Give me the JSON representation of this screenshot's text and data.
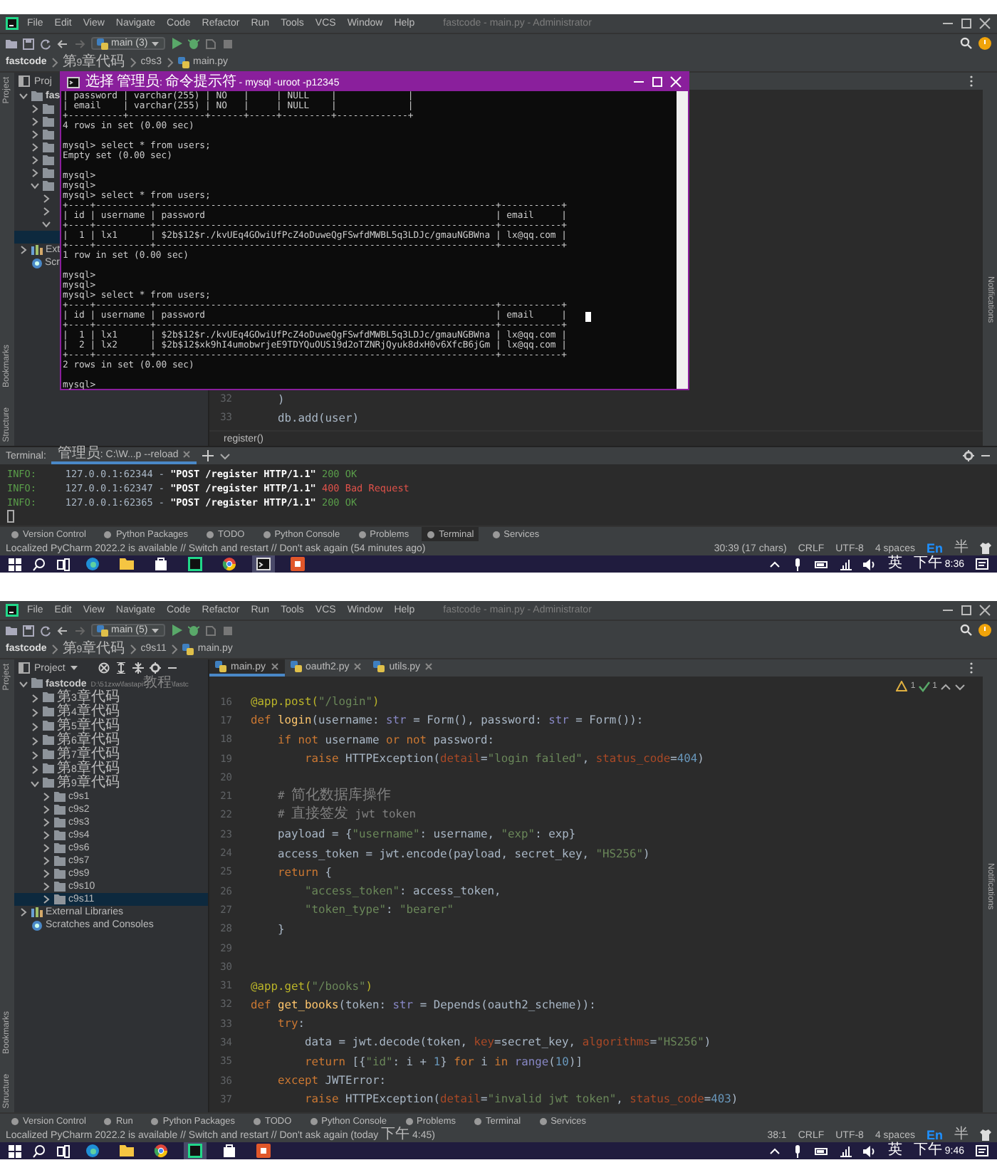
{
  "screens": [
    {
      "title": "fastcode - main.py - Administrator",
      "menu": [
        "File",
        "Edit",
        "View",
        "Navigate",
        "Code",
        "Refactor",
        "Run",
        "Tools",
        "VCS",
        "Window",
        "Help"
      ],
      "branch": "main (3)",
      "breadcrumb": [
        "fastcode",
        "第9章代码",
        "c9s3",
        "main.py"
      ],
      "side_strip": {
        "top": "Project",
        "bottom": [
          "Bookmarks",
          "Structure"
        ]
      },
      "project_panel": {
        "header": "Proj",
        "tree": [
          {
            "kind": "root",
            "label": "fas",
            "expanded": true,
            "selected": false,
            "children": [
              {
                "kind": "folder",
                "expanded": false,
                "selected": false
              },
              {
                "kind": "folder",
                "expanded": false,
                "selected": false
              },
              {
                "kind": "folder",
                "expanded": false,
                "selected": false
              },
              {
                "kind": "folder",
                "expanded": false,
                "selected": false
              },
              {
                "kind": "folder",
                "expanded": false,
                "selected": false
              },
              {
                "kind": "folder",
                "expanded": false,
                "selected": false
              },
              {
                "kind": "folder",
                "expanded": true,
                "selected": false,
                "children": [
                  {
                    "kind": "folder",
                    "expanded": false,
                    "selected": false
                  },
                  {
                    "kind": "folder",
                    "expanded": false,
                    "selected": false
                  },
                  {
                    "kind": "folder",
                    "expanded": true,
                    "selected": false,
                    "children": [
                      {
                        "selected": true
                      }
                    ]
                  }
                ]
              }
            ]
          },
          {
            "kind": "library",
            "label": "Ext",
            "expanded": false,
            "selected": false
          },
          {
            "kind": "scratches",
            "label": "Scr",
            "selected": false
          }
        ]
      },
      "editor": {
        "lines": [
          {
            "number": "32",
            "tokens": [
              {
                "kind": "plain",
                "text": "    )"
              }
            ]
          },
          {
            "number": "33",
            "tokens": [
              {
                "kind": "plain",
                "text": "    db.add(user)"
              }
            ]
          }
        ],
        "breadcrumb": "register()"
      },
      "terminal": {
        "label": "Terminal:",
        "tabs": [
          {
            "label": "管理员: C:\\W...p --reload",
            "selected": true
          }
        ],
        "lines": [
          {
            "tokens": [
              {
                "kind": "info",
                "text": "INFO:"
              },
              {
                "kind": "plain",
                "text": "     127.0.0.1:62344 - "
              },
              {
                "kind": "bold",
                "text": "\"POST /register HTTP/1.1\""
              },
              {
                "kind": "ok",
                "text": " 200 OK"
              }
            ]
          },
          {
            "tokens": [
              {
                "kind": "info",
                "text": "INFO:"
              },
              {
                "kind": "plain",
                "text": "     127.0.0.1:62347 - "
              },
              {
                "kind": "bold",
                "text": "\"POST /register HTTP/1.1\""
              },
              {
                "kind": "err",
                "text": " 400 Bad Request"
              }
            ]
          },
          {
            "tokens": [
              {
                "kind": "info",
                "text": "INFO:"
              },
              {
                "kind": "plain",
                "text": "     127.0.0.1:62365 - "
              },
              {
                "kind": "bold",
                "text": "\"POST /register HTTP/1.1\""
              },
              {
                "kind": "ok",
                "text": " 200 OK"
              }
            ]
          }
        ]
      },
      "console_window": {
        "title": "选择 管理员: 命令提示符 - mysql -uroot -p12345",
        "lines": [
          {
            "text": "| password | varchar(255) | NO   |     | NULL    |             |"
          },
          {
            "text": "| email    | varchar(255) | NO   |     | NULL    |             |"
          },
          {
            "text": "+----------+--------------+------+-----+---------+-------------+"
          },
          {
            "text": "4 rows in set (0.00 sec)"
          },
          {
            "text": "mysql> select * from users;",
            "gap_before": true
          },
          {
            "text": "Empty set (0.00 sec)"
          },
          {
            "text": "mysql>",
            "gap_before": true
          },
          {
            "text": "mysql>"
          },
          {
            "text": "mysql> select * from users;"
          },
          {
            "text": "+----+----------+--------------------------------------------------------------+-----------+"
          },
          {
            "text": "| id | username | password                                                     | email     |"
          },
          {
            "text": "+----+----------+--------------------------------------------------------------+-----------+"
          },
          {
            "text": "|  1 | lx1      | $2b$12$r./kvUEq4GOwiUfPcZ4oDuweQgFSwfdMWBL5q3LDJc/gmauNGBWna | lx@qq.com |"
          },
          {
            "text": "+----+----------+--------------------------------------------------------------+-----------+"
          },
          {
            "text": "1 row in set (0.00 sec)"
          },
          {
            "text": "mysql>",
            "gap_before": true
          },
          {
            "text": "mysql>"
          },
          {
            "text": "mysql> select * from users;"
          },
          {
            "text": "+----+----------+--------------------------------------------------------------+-----------+"
          },
          {
            "text": "| id | username | password                                                     | email     |"
          },
          {
            "text": "+----+----------+--------------------------------------------------------------+-----------+"
          },
          {
            "text": "|  1 | lx1      | $2b$12$r./kvUEq4GOwiUfPcZ4oDuweQgFSwfdMWBL5q3LDJc/gmauNGBWna | lx@qq.com |"
          },
          {
            "text": "|  2 | lx2      | $2b$12$xk9hI4umobwrjeE9TDYQuOUS19d2oTZNRjQyuk8dxH0v6XfcB6jGm | lx@qq.com |"
          },
          {
            "text": "+----+----------+--------------------------------------------------------------+-----------+"
          },
          {
            "text": "2 rows in set (0.00 sec)"
          },
          {
            "text": "mysql>",
            "gap_before": true
          }
        ]
      },
      "tool_tabs": [
        {
          "label": "Version Control",
          "selected": false
        },
        {
          "label": "Python Packages",
          "selected": false
        },
        {
          "label": "TODO",
          "selected": false
        },
        {
          "label": "Python Console",
          "selected": false
        },
        {
          "label": "Problems",
          "selected": false
        },
        {
          "label": "Terminal",
          "selected": true
        },
        {
          "label": "Services",
          "selected": false
        }
      ],
      "notifications": "Notifications",
      "status_bar": {
        "message": "Localized PyCharm 2022.2 is available // Switch and restart // Don't ask again (54 minutes ago)",
        "items": [
          "30:39 (17 chars)",
          "CRLF",
          "UTF-8",
          "4 spaces"
        ],
        "ime": "En",
        "ime_mode": "半"
      },
      "taskbar": {
        "apps": [
          {
            "kind": "browser",
            "active": false
          },
          {
            "kind": "folder",
            "active": false
          },
          {
            "kind": "store",
            "active": false
          },
          {
            "kind": "ide",
            "active": false
          },
          {
            "kind": "chrome",
            "active": false
          },
          {
            "kind": "console",
            "active": true
          },
          {
            "kind": "office",
            "active": false
          }
        ],
        "lang": "英",
        "clock": "下午 8:36"
      }
    },
    {
      "title": "fastcode - main.py - Administrator",
      "menu": [
        "File",
        "Edit",
        "View",
        "Navigate",
        "Code",
        "Refactor",
        "Run",
        "Tools",
        "VCS",
        "Window",
        "Help"
      ],
      "branch": "main (5)",
      "breadcrumb": [
        "fastcode",
        "第9章代码",
        "c9s11",
        "main.py"
      ],
      "side_strip": {
        "top": "Project",
        "bottom": [
          "Bookmarks",
          "Structure"
        ]
      },
      "project_panel": {
        "header": "Project",
        "tree": [
          {
            "kind": "root",
            "label": "fastcode",
            "path": "D:\\51zxw\\fastapi教程\\fastc",
            "expanded": true,
            "selected": false,
            "children": [
              {
                "kind": "folder",
                "label": "第3章代码",
                "expanded": false,
                "selected": false
              },
              {
                "kind": "folder",
                "label": "第4章代码",
                "expanded": false,
                "selected": false
              },
              {
                "kind": "folder",
                "label": "第5章代码",
                "expanded": false,
                "selected": false
              },
              {
                "kind": "folder",
                "label": "第6章代码",
                "expanded": false,
                "selected": false
              },
              {
                "kind": "folder",
                "label": "第7章代码",
                "expanded": false,
                "selected": false
              },
              {
                "kind": "folder",
                "label": "第8章代码",
                "expanded": false,
                "selected": false
              },
              {
                "kind": "folder",
                "label": "第9章代码",
                "expanded": true,
                "selected": false,
                "children": [
                  {
                    "kind": "folder",
                    "label": "c9s1",
                    "expanded": false,
                    "selected": false
                  },
                  {
                    "kind": "folder",
                    "label": "c9s2",
                    "expanded": false,
                    "selected": false
                  },
                  {
                    "kind": "folder",
                    "label": "c9s3",
                    "expanded": false,
                    "selected": false
                  },
                  {
                    "kind": "folder",
                    "label": "c9s4",
                    "expanded": false,
                    "selected": false
                  },
                  {
                    "kind": "folder",
                    "label": "c9s6",
                    "expanded": false,
                    "selected": false
                  },
                  {
                    "kind": "folder",
                    "label": "c9s7",
                    "expanded": false,
                    "selected": false
                  },
                  {
                    "kind": "folder",
                    "label": "c9s9",
                    "expanded": false,
                    "selected": false
                  },
                  {
                    "kind": "folder",
                    "label": "c9s10",
                    "expanded": false,
                    "selected": false
                  },
                  {
                    "kind": "folder",
                    "label": "c9s11",
                    "expanded": false,
                    "selected": true
                  }
                ]
              }
            ]
          },
          {
            "kind": "library",
            "label": "External Libraries",
            "expanded": false,
            "selected": false
          },
          {
            "kind": "scratches",
            "label": "Scratches and Consoles",
            "selected": false
          }
        ]
      },
      "editor_tabs": [
        {
          "label": "main.py",
          "selected": true
        },
        {
          "label": "oauth2.py",
          "selected": false
        },
        {
          "label": "utils.py",
          "selected": false
        }
      ],
      "inspections": {
        "warnings": "1",
        "passed": "1"
      },
      "editor": {
        "lines": [
          {
            "number": "16",
            "tokens": [
              {
                "kind": "deco",
                "text": "@app.post("
              },
              {
                "kind": "str",
                "text": "\"/login\""
              },
              {
                "kind": "deco",
                "text": ")"
              }
            ]
          },
          {
            "number": "17",
            "tokens": [
              {
                "kind": "kw",
                "text": "def "
              },
              {
                "kind": "fn",
                "text": "login"
              },
              {
                "kind": "plain",
                "text": "(username: "
              },
              {
                "kind": "builtin",
                "text": "str"
              },
              {
                "kind": "plain",
                "text": " = Form(), password: "
              },
              {
                "kind": "builtin",
                "text": "str"
              },
              {
                "kind": "plain",
                "text": " = Form()):"
              }
            ]
          },
          {
            "number": "18",
            "tokens": [
              {
                "kind": "kw",
                "text": "    if not"
              },
              {
                "kind": "plain",
                "text": " username "
              },
              {
                "kind": "kw",
                "text": "or not"
              },
              {
                "kind": "plain",
                "text": " password:"
              }
            ]
          },
          {
            "number": "19",
            "tokens": [
              {
                "kind": "kw",
                "text": "        raise"
              },
              {
                "kind": "plain",
                "text": " HTTPException("
              },
              {
                "kind": "param",
                "text": "detail"
              },
              {
                "kind": "plain",
                "text": "="
              },
              {
                "kind": "str",
                "text": "\"login failed\""
              },
              {
                "kind": "plain",
                "text": ", "
              },
              {
                "kind": "param",
                "text": "status_code"
              },
              {
                "kind": "plain",
                "text": "="
              },
              {
                "kind": "num",
                "text": "404"
              },
              {
                "kind": "plain",
                "text": ")"
              }
            ]
          },
          {
            "number": "20"
          },
          {
            "number": "21",
            "tokens": [
              {
                "kind": "comment",
                "text": "    # 简化数据库操作"
              }
            ]
          },
          {
            "number": "22",
            "tokens": [
              {
                "kind": "comment",
                "text": "    # 直接签发 jwt token"
              }
            ]
          },
          {
            "number": "23",
            "tokens": [
              {
                "kind": "plain",
                "text": "    payload = {"
              },
              {
                "kind": "str",
                "text": "\"username\""
              },
              {
                "kind": "plain",
                "text": ": username, "
              },
              {
                "kind": "str",
                "text": "\"exp\""
              },
              {
                "kind": "plain",
                "text": ": exp}"
              }
            ]
          },
          {
            "number": "24",
            "tokens": [
              {
                "kind": "plain",
                "text": "    access_token = jwt.encode(payload, secret_key, "
              },
              {
                "kind": "str",
                "text": "\"HS256\""
              },
              {
                "kind": "plain",
                "text": ")"
              }
            ]
          },
          {
            "number": "25",
            "tokens": [
              {
                "kind": "kw",
                "text": "    return"
              },
              {
                "kind": "plain",
                "text": " {"
              }
            ]
          },
          {
            "number": "26",
            "tokens": [
              {
                "kind": "str",
                "text": "        \"access_token\""
              },
              {
                "kind": "plain",
                "text": ": access_token,"
              }
            ]
          },
          {
            "number": "27",
            "tokens": [
              {
                "kind": "str",
                "text": "        \"token_type\""
              },
              {
                "kind": "plain",
                "text": ": "
              },
              {
                "kind": "str",
                "text": "\"bearer\""
              }
            ]
          },
          {
            "number": "28",
            "tokens": [
              {
                "kind": "plain",
                "text": "    }"
              }
            ]
          },
          {
            "number": "29"
          },
          {
            "number": "30"
          },
          {
            "number": "31",
            "tokens": [
              {
                "kind": "deco",
                "text": "@app.get("
              },
              {
                "kind": "str",
                "text": "\"/books\""
              },
              {
                "kind": "deco",
                "text": ")"
              }
            ]
          },
          {
            "number": "32",
            "tokens": [
              {
                "kind": "kw",
                "text": "def "
              },
              {
                "kind": "fn",
                "text": "get_books"
              },
              {
                "kind": "plain",
                "text": "(token: "
              },
              {
                "kind": "builtin",
                "text": "str"
              },
              {
                "kind": "plain",
                "text": " = Depends(oauth2_scheme)):"
              }
            ]
          },
          {
            "number": "33",
            "tokens": [
              {
                "kind": "kw",
                "text": "    try"
              },
              {
                "kind": "plain",
                "text": ":"
              }
            ]
          },
          {
            "number": "34",
            "tokens": [
              {
                "kind": "plain",
                "text": "        data = jwt.decode(token, "
              },
              {
                "kind": "param",
                "text": "key"
              },
              {
                "kind": "plain",
                "text": "=secret_key, "
              },
              {
                "kind": "param",
                "text": "algorithms"
              },
              {
                "kind": "plain",
                "text": "="
              },
              {
                "kind": "str",
                "text": "\"HS256\""
              },
              {
                "kind": "plain",
                "text": ")"
              }
            ]
          },
          {
            "number": "35",
            "tokens": [
              {
                "kind": "kw",
                "text": "        return"
              },
              {
                "kind": "plain",
                "text": " [{"
              },
              {
                "kind": "str",
                "text": "\"id\""
              },
              {
                "kind": "plain",
                "text": ": i + "
              },
              {
                "kind": "num",
                "text": "1"
              },
              {
                "kind": "plain",
                "text": "} "
              },
              {
                "kind": "kw",
                "text": "for"
              },
              {
                "kind": "plain",
                "text": " i "
              },
              {
                "kind": "kw",
                "text": "in "
              },
              {
                "kind": "builtin",
                "text": "range"
              },
              {
                "kind": "plain",
                "text": "("
              },
              {
                "kind": "num",
                "text": "10"
              },
              {
                "kind": "plain",
                "text": ")]"
              }
            ]
          },
          {
            "number": "36",
            "tokens": [
              {
                "kind": "kw",
                "text": "    except"
              },
              {
                "kind": "plain",
                "text": " JWTError:"
              }
            ]
          },
          {
            "number": "37",
            "tokens": [
              {
                "kind": "kw",
                "text": "        raise"
              },
              {
                "kind": "plain",
                "text": " HTTPException("
              },
              {
                "kind": "param",
                "text": "detail"
              },
              {
                "kind": "plain",
                "text": "="
              },
              {
                "kind": "str",
                "text": "\"invalid jwt token\""
              },
              {
                "kind": "plain",
                "text": ", "
              },
              {
                "kind": "param",
                "text": "status_code"
              },
              {
                "kind": "plain",
                "text": "="
              },
              {
                "kind": "num",
                "text": "403"
              },
              {
                "kind": "plain",
                "text": ")"
              }
            ]
          }
        ]
      },
      "tool_tabs": [
        {
          "label": "Version Control",
          "selected": false
        },
        {
          "label": "Run",
          "selected": false
        },
        {
          "label": "Python Packages",
          "selected": false
        },
        {
          "label": "TODO",
          "selected": false
        },
        {
          "label": "Python Console",
          "selected": false
        },
        {
          "label": "Problems",
          "selected": false
        },
        {
          "label": "Terminal",
          "selected": false
        },
        {
          "label": "Services",
          "selected": false
        }
      ],
      "notifications": "Notifications",
      "status_bar": {
        "message": "Localized PyCharm 2022.2 is available // Switch and restart // Don't ask again (today 下午 4:45)",
        "items": [
          "38:1",
          "CRLF",
          "UTF-8",
          "4 spaces"
        ],
        "ime": "En",
        "ime_mode": "半"
      },
      "taskbar": {
        "apps": [
          {
            "kind": "browser",
            "active": false
          },
          {
            "kind": "folder",
            "active": false
          },
          {
            "kind": "chrome",
            "active": false
          },
          {
            "kind": "ide",
            "active": true
          },
          {
            "kind": "store",
            "active": false
          },
          {
            "kind": "office",
            "active": false
          }
        ],
        "lang": "英",
        "clock": "下午 9:46"
      }
    }
  ]
}
